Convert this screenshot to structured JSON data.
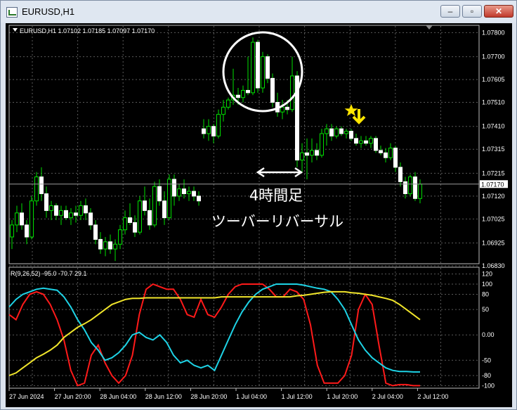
{
  "window": {
    "title": "EURUSD,H1"
  },
  "chart_data": [
    {
      "type": "candlestick",
      "header": "EURUSD,H1  1.07102 1.07185 1.07097 1.07170",
      "ylim": [
        1.0683,
        1.0781
      ],
      "y_ticks": [
        "1.07800",
        "1.07700",
        "1.07605",
        "1.07510",
        "1.07410",
        "1.07315",
        "1.07215",
        "1.07120",
        "1.07025",
        "1.06925",
        "1.06830"
      ],
      "current_price": "1.07170",
      "grid": true,
      "candles": [
        [
          1.0695,
          1.0702,
          1.069,
          1.07
        ],
        [
          1.07,
          1.0708,
          1.0697,
          1.0705
        ],
        [
          1.0705,
          1.0709,
          1.0698,
          1.07
        ],
        [
          1.07,
          1.0702,
          1.0692,
          1.0695
        ],
        [
          1.0695,
          1.0712,
          1.0694,
          1.071
        ],
        [
          1.071,
          1.0722,
          1.0708,
          1.072
        ],
        [
          1.072,
          1.0724,
          1.071,
          1.0713
        ],
        [
          1.0713,
          1.0716,
          1.0703,
          1.0706
        ],
        [
          1.0706,
          1.071,
          1.0702,
          1.0708
        ],
        [
          1.0708,
          1.0709,
          1.0702,
          1.0704
        ],
        [
          1.0704,
          1.0708,
          1.07,
          1.0706
        ],
        [
          1.0706,
          1.0708,
          1.0702,
          1.0703
        ],
        [
          1.0703,
          1.0707,
          1.07,
          1.0705
        ],
        [
          1.0705,
          1.0708,
          1.0701,
          1.0704
        ],
        [
          1.0704,
          1.071,
          1.0702,
          1.0708
        ],
        [
          1.0708,
          1.0711,
          1.0702,
          1.0705
        ],
        [
          1.0705,
          1.0707,
          1.0698,
          1.07
        ],
        [
          1.07,
          1.0702,
          1.0692,
          1.0694
        ],
        [
          1.0694,
          1.0697,
          1.0688,
          1.069
        ],
        [
          1.069,
          1.0695,
          1.0687,
          1.0693
        ],
        [
          1.0693,
          1.0696,
          1.0688,
          1.069
        ],
        [
          1.069,
          1.0694,
          1.0685,
          1.0692
        ],
        [
          1.0692,
          1.07,
          1.069,
          1.0698
        ],
        [
          1.0698,
          1.0706,
          1.0696,
          1.0703
        ],
        [
          1.0703,
          1.0709,
          1.07,
          1.0701
        ],
        [
          1.0701,
          1.0704,
          1.0695,
          1.0697
        ],
        [
          1.0697,
          1.0712,
          1.0696,
          1.071
        ],
        [
          1.071,
          1.0716,
          1.0704,
          1.0706
        ],
        [
          1.0706,
          1.0711,
          1.0698,
          1.07
        ],
        [
          1.07,
          1.0718,
          1.0699,
          1.0716
        ],
        [
          1.0716,
          1.0719,
          1.0708,
          1.071
        ],
        [
          1.071,
          1.0714,
          1.07,
          1.0703
        ],
        [
          1.0703,
          1.0721,
          1.0702,
          1.0719
        ],
        [
          1.0719,
          1.0721,
          1.0708,
          1.0712
        ],
        [
          1.0712,
          1.0717,
          1.071,
          1.0715
        ],
        [
          1.0715,
          1.0719,
          1.0711,
          1.0713
        ],
        [
          1.0713,
          1.0716,
          1.071,
          1.0714
        ],
        [
          1.0714,
          1.0716,
          1.071,
          1.0712
        ],
        [
          1.0712,
          1.0714,
          1.0708,
          1.071
        ],
        [
          1.074,
          1.0744,
          1.0736,
          1.0738
        ],
        [
          1.0738,
          1.0744,
          1.0735,
          1.0741
        ],
        [
          1.0741,
          1.0742,
          1.0734,
          1.0737
        ],
        [
          1.0737,
          1.0748,
          1.0736,
          1.0746
        ],
        [
          1.0746,
          1.0752,
          1.0743,
          1.0749
        ],
        [
          1.0749,
          1.0753,
          1.0748,
          1.0752
        ],
        [
          1.0752,
          1.0765,
          1.075,
          1.0754
        ],
        [
          1.0754,
          1.0757,
          1.075,
          1.0753
        ],
        [
          1.0753,
          1.0758,
          1.0751,
          1.0756
        ],
        [
          1.0756,
          1.077,
          1.0754,
          1.0755
        ],
        [
          1.0755,
          1.0778,
          1.0754,
          1.0776
        ],
        [
          1.0776,
          1.0777,
          1.0755,
          1.0757
        ],
        [
          1.0757,
          1.0772,
          1.0755,
          1.077
        ],
        [
          1.077,
          1.0771,
          1.0759,
          1.0761
        ],
        [
          1.0761,
          1.0763,
          1.0749,
          1.0751
        ],
        [
          1.0751,
          1.0755,
          1.0745,
          1.0747
        ],
        [
          1.0747,
          1.0752,
          1.0744,
          1.0749
        ],
        [
          1.0749,
          1.0752,
          1.0746,
          1.0748
        ],
        [
          1.0748,
          1.077,
          1.0747,
          1.0762
        ],
        [
          1.0762,
          1.0764,
          1.0724,
          1.0727
        ],
        [
          1.0727,
          1.0734,
          1.0722,
          1.073
        ],
        [
          1.073,
          1.0736,
          1.0719,
          1.0729
        ],
        [
          1.0729,
          1.0736,
          1.0726,
          1.0731
        ],
        [
          1.0731,
          1.0734,
          1.0727,
          1.0729
        ],
        [
          1.0729,
          1.074,
          1.0728,
          1.0738
        ],
        [
          1.0738,
          1.0742,
          1.0733,
          1.074
        ],
        [
          1.074,
          1.0742,
          1.0735,
          1.0737
        ],
        [
          1.0737,
          1.0741,
          1.0736,
          1.074
        ],
        [
          1.074,
          1.0741,
          1.0737,
          1.0738
        ],
        [
          1.0738,
          1.074,
          1.0736,
          1.0739
        ],
        [
          1.0739,
          1.074,
          1.0735,
          1.0736
        ],
        [
          1.0736,
          1.0738,
          1.0733,
          1.0734
        ],
        [
          1.0734,
          1.0737,
          1.0732,
          1.0735
        ],
        [
          1.0735,
          1.0737,
          1.0733,
          1.0734
        ],
        [
          1.0734,
          1.0737,
          1.0732,
          1.0736
        ],
        [
          1.0736,
          1.0737,
          1.073,
          1.0731
        ],
        [
          1.0731,
          1.0733,
          1.0729,
          1.073
        ],
        [
          1.073,
          1.0732,
          1.0726,
          1.0728
        ],
        [
          1.0728,
          1.0734,
          1.0727,
          1.0732
        ],
        [
          1.0732,
          1.0733,
          1.0722,
          1.0724
        ],
        [
          1.0724,
          1.0726,
          1.0716,
          1.0718
        ],
        [
          1.0718,
          1.072,
          1.0711,
          1.0713
        ],
        [
          1.0713,
          1.0721,
          1.0712,
          1.072
        ],
        [
          1.072,
          1.0722,
          1.071,
          1.0711
        ],
        [
          1.0711,
          1.0719,
          1.0709,
          1.0717
        ]
      ],
      "annotation_line1": "4時間足",
      "annotation_line2": "ツーバーリバーサル"
    },
    {
      "type": "line",
      "header": "R(9,26,52) -95.0 -70.7 29.1",
      "ylim": [
        -105,
        125
      ],
      "y_ticks": [
        "120",
        "100",
        "80",
        "50",
        "0.00",
        "-50",
        "-80",
        "-100"
      ],
      "grid": true,
      "x_labels": [
        "27 Jun 2024",
        "27 Jun 20:00",
        "28 Jun 04:00",
        "28 Jun 12:00",
        "28 Jun 20:00",
        "1 Jul 04:00",
        "1 Jul 12:00",
        "1 Jul 20:00",
        "2 Jul 04:00",
        "2 Jul 12:00"
      ],
      "series": [
        {
          "color": "#ff1a1a",
          "values": [
            40,
            30,
            60,
            80,
            85,
            80,
            60,
            30,
            -10,
            -70,
            -100,
            -95,
            -40,
            -20,
            -55,
            -80,
            -95,
            -80,
            -40,
            40,
            90,
            100,
            95,
            90,
            90,
            70,
            40,
            35,
            70,
            40,
            35,
            55,
            80,
            95,
            100,
            100,
            100,
            100,
            90,
            75,
            75,
            90,
            85,
            70,
            20,
            -60,
            -95,
            -95,
            -95,
            -80,
            -40,
            50,
            80,
            60,
            -20,
            -95,
            -100,
            -98,
            -98,
            -100,
            -100
          ]
        },
        {
          "color": "#1ed3e6",
          "values": [
            55,
            70,
            80,
            85,
            90,
            92,
            90,
            88,
            75,
            55,
            30,
            10,
            -15,
            -30,
            -50,
            -45,
            -35,
            -20,
            0,
            5,
            -5,
            -10,
            0,
            -15,
            -40,
            -55,
            -50,
            -60,
            -65,
            -60,
            -70,
            -40,
            -10,
            20,
            45,
            65,
            80,
            90,
            95,
            100,
            100,
            100,
            100,
            98,
            95,
            92,
            90,
            85,
            70,
            50,
            20,
            -10,
            -30,
            -45,
            -55,
            -65,
            -70,
            -72,
            -72,
            -73,
            -73
          ]
        },
        {
          "color": "#f0e52b",
          "values": [
            -80,
            -75,
            -65,
            -55,
            -45,
            -38,
            -30,
            -20,
            -5,
            5,
            15,
            22,
            30,
            40,
            50,
            60,
            65,
            70,
            72,
            72,
            73,
            73,
            73,
            73,
            73,
            73,
            73,
            73,
            73,
            73,
            73,
            75,
            75,
            75,
            75,
            75,
            75,
            75,
            75,
            75,
            75,
            75,
            77,
            78,
            80,
            82,
            84,
            85,
            85,
            85,
            83,
            82,
            80,
            78,
            75,
            72,
            68,
            60,
            50,
            40,
            30
          ]
        }
      ]
    }
  ]
}
